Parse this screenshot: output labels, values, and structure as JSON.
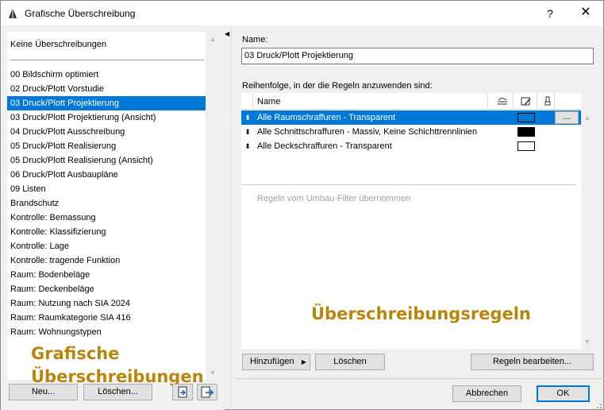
{
  "window": {
    "title": "Grafische Überschreibung",
    "help_glyph": "?",
    "close_glyph": "✕"
  },
  "left": {
    "no_override": "Keine Überschreibungen",
    "items": [
      "00 Bildschirm optimiert",
      "02 Druck/Plott Vorstudie",
      "03 Druck/Plott Projektierung",
      "03 Druck/Plott Projektierung (Ansicht)",
      "04 Druck/Plott Ausschreibung",
      "05 Druck/Plott Realisierung",
      "05 Druck/Plott Realisierung (Ansicht)",
      "06 Druck/Plott Ausbaupläne",
      "09 Listen",
      "Brandschutz",
      "Kontrolle: Bemassung",
      "Kontrolle: Klassifizierung",
      "Kontrolle: Lage",
      "Kontrolle: tragende Funktion",
      "Raum: Bodenbeläge",
      "Raum: Deckenbeläge",
      "Raum: Nutzung nach SIA 2024",
      "Raum: Raumkategorie SIA 416",
      "Raum: Wohnungstypen"
    ],
    "selected_index": 2,
    "overlay_line1": "Grafische",
    "overlay_line2": "Überschreibungen",
    "new_label": "Neu...",
    "delete_label": "Löschen..."
  },
  "right": {
    "name_label": "Name:",
    "name_value": "03 Druck/Plott Projektierung",
    "order_label": "Reihenfolge, in der die Regeln anzuwenden sind:",
    "col_name": "Name",
    "rules": [
      {
        "name": "Alle Raumschraffuren - Transparent",
        "fill": "#0078d7",
        "selected": true
      },
      {
        "name": "Alle Schnittschraffuren - Massiv, Keine Schichttrennlinien",
        "fill": "#000000",
        "selected": false
      },
      {
        "name": "Alle Deckschraffuren - Transparent",
        "fill": "#ffffff",
        "selected": false
      }
    ],
    "dots_label": "...",
    "umbau_text": "Regeln vom Umbau-Filter übernommen",
    "overlay": "Überschreibungsregeln",
    "add_label": "Hinzufügen",
    "delete_label": "Löschen",
    "edit_label": "Regeln bearbeiten...",
    "cancel_label": "Abbrechen",
    "ok_label": "OK"
  },
  "colors": {
    "selection": "#0078d7",
    "overlay_text": "#b8860b"
  }
}
